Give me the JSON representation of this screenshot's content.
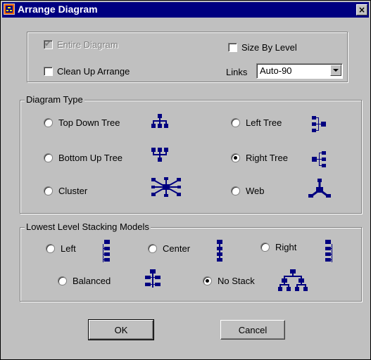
{
  "window": {
    "title": "Arrange Diagram",
    "close_glyph": "×"
  },
  "options": {
    "entire_diagram": {
      "label": "Entire Diagram",
      "checked": true,
      "disabled": true
    },
    "size_by_level": {
      "label": "Size By Level",
      "checked": false
    },
    "clean_up_arrange": {
      "label": "Clean Up Arrange",
      "checked": false
    },
    "links": {
      "label": "Links",
      "value": "Auto-90"
    }
  },
  "diagram_type": {
    "label": "Diagram Type",
    "items": [
      {
        "label": "Top Down Tree",
        "checked": false,
        "icon": "top-down-tree-icon"
      },
      {
        "label": "Left Tree",
        "checked": false,
        "icon": "left-tree-icon"
      },
      {
        "label": "Bottom Up Tree",
        "checked": false,
        "icon": "bottom-up-tree-icon"
      },
      {
        "label": "Right Tree",
        "checked": true,
        "icon": "right-tree-icon"
      },
      {
        "label": "Cluster",
        "checked": false,
        "icon": "cluster-icon"
      },
      {
        "label": "Web",
        "checked": false,
        "icon": "web-icon"
      }
    ]
  },
  "stacking": {
    "label": "Lowest Level Stacking Models",
    "items": [
      {
        "label": "Left",
        "checked": false,
        "icon": "stack-left-icon"
      },
      {
        "label": "Center",
        "checked": false,
        "icon": "stack-center-icon"
      },
      {
        "label": "Right",
        "checked": false,
        "icon": "stack-right-icon"
      },
      {
        "label": "Balanced",
        "checked": false,
        "icon": "stack-balanced-icon"
      },
      {
        "label": "No Stack",
        "checked": true,
        "icon": "no-stack-icon"
      }
    ]
  },
  "buttons": {
    "ok": "OK",
    "cancel": "Cancel"
  },
  "colors": {
    "title_bar": "#000080",
    "icon_blue": "#000080",
    "dialog_gray": "#c0c0c0"
  }
}
